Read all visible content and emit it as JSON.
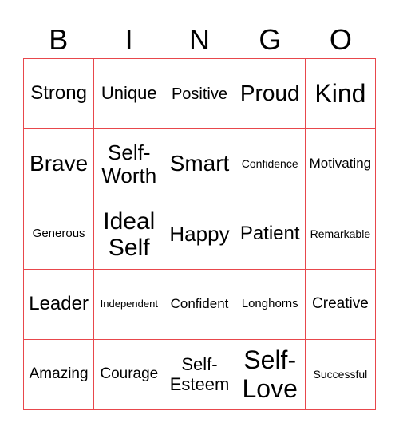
{
  "header": [
    "B",
    "I",
    "N",
    "G",
    "O"
  ],
  "accent_color": "#e8474c",
  "cells": [
    "Strong",
    "Unique",
    "Positive",
    "Proud",
    "Kind",
    "Brave",
    "Self-\nWorth",
    "Smart",
    "Confidence",
    "Motivating",
    "Generous",
    "Ideal\nSelf",
    "Happy",
    "Patient",
    "Remarkable",
    "Leader",
    "Independent",
    "Confident",
    "Longhorns",
    "Creative",
    "Amazing",
    "Courage",
    "Self-\nEsteem",
    "Self-\nLove",
    "Successful"
  ]
}
